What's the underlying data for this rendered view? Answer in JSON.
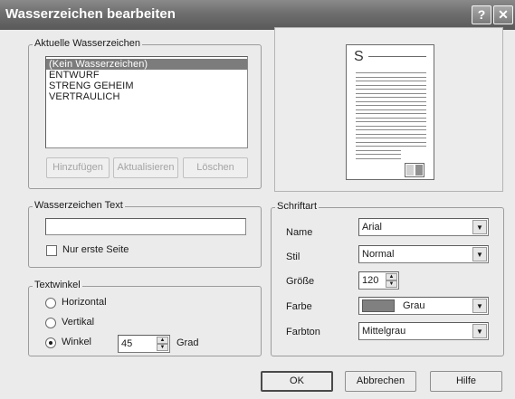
{
  "window": {
    "title": "Wasserzeichen bearbeiten",
    "help_glyph": "?",
    "close_glyph": "✕"
  },
  "current_watermarks": {
    "group_label": "Aktuelle Wasserzeichen",
    "items": [
      "(Kein Wasserzeichen)",
      "ENTWURF",
      "STRENG GEHEIM",
      "VERTRAULICH"
    ],
    "selected_index": 0,
    "add_label": "Hinzufügen",
    "update_label": "Aktualisieren",
    "delete_label": "Löschen"
  },
  "preview": {
    "letter": "S"
  },
  "watermark_text": {
    "group_label": "Wasserzeichen Text",
    "value": "",
    "first_page_only_label": "Nur erste Seite",
    "first_page_only_checked": false
  },
  "text_angle": {
    "group_label": "Textwinkel",
    "horizontal_label": "Horizontal",
    "vertical_label": "Vertikal",
    "angle_label": "Winkel",
    "selected": "angle",
    "angle_value": "45",
    "unit_label": "Grad"
  },
  "font": {
    "group_label": "Schriftart",
    "name_label": "Name",
    "name_value": "Arial",
    "style_label": "Stil",
    "style_value": "Normal",
    "size_label": "Größe",
    "size_value": "120",
    "color_label": "Farbe",
    "color_value": "Grau",
    "color_swatch": "#808080",
    "shade_label": "Farbton",
    "shade_value": "Mittelgrau"
  },
  "footer": {
    "ok_label": "OK",
    "cancel_label": "Abbrechen",
    "help_label": "Hilfe"
  }
}
